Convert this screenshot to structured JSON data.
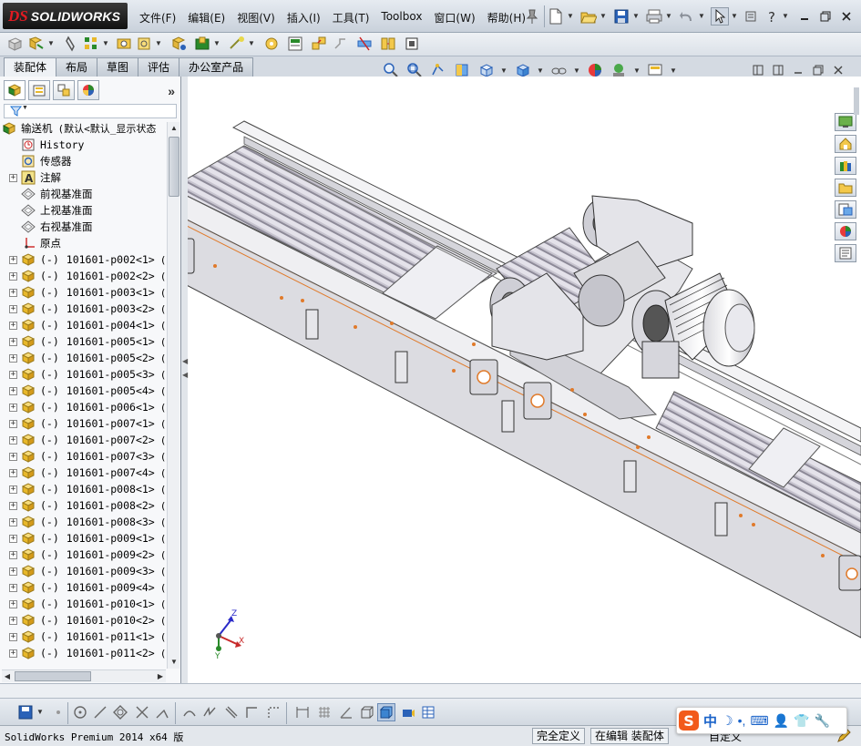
{
  "app": {
    "logo_ds": "DS",
    "logo_name": "SOLIDWORKS"
  },
  "menu": [
    {
      "label": "文件(F)"
    },
    {
      "label": "编辑(E)"
    },
    {
      "label": "视图(V)"
    },
    {
      "label": "插入(I)"
    },
    {
      "label": "工具(T)"
    },
    {
      "label": "Toolbox"
    },
    {
      "label": "窗口(W)"
    },
    {
      "label": "帮助(H)"
    }
  ],
  "command_tabs": [
    {
      "label": "装配体",
      "active": true
    },
    {
      "label": "布局",
      "active": false
    },
    {
      "label": "草图",
      "active": false
    },
    {
      "label": "评估",
      "active": false
    },
    {
      "label": "办公室产品",
      "active": false
    }
  ],
  "feature_tree": {
    "root": {
      "label": "输送机",
      "config": "(默认<默认_显示状态"
    },
    "items": [
      {
        "label": "History",
        "icon": "history-icon"
      },
      {
        "label": "传感器",
        "icon": "sensor-icon"
      },
      {
        "label": "注解",
        "icon": "annotation-icon",
        "expandable": true
      },
      {
        "label": "前视基准面",
        "icon": "plane-icon"
      },
      {
        "label": "上视基准面",
        "icon": "plane-icon"
      },
      {
        "label": "右视基准面",
        "icon": "plane-icon"
      },
      {
        "label": "原点",
        "icon": "origin-icon"
      }
    ],
    "components": [
      {
        "prefix": "(-)",
        "name": "101601-p002<1>",
        "config": "(默认"
      },
      {
        "prefix": "(-)",
        "name": "101601-p002<2>",
        "config": "(默认"
      },
      {
        "prefix": "(-)",
        "name": "101601-p003<1>",
        "config": "(默认"
      },
      {
        "prefix": "(-)",
        "name": "101601-p003<2>",
        "config": "(默认"
      },
      {
        "prefix": "(-)",
        "name": "101601-p004<1>",
        "config": "(默认"
      },
      {
        "prefix": "(-)",
        "name": "101601-p005<1>",
        "config": "(默认"
      },
      {
        "prefix": "(-)",
        "name": "101601-p005<2>",
        "config": "(默认"
      },
      {
        "prefix": "(-)",
        "name": "101601-p005<3>",
        "config": "(默认"
      },
      {
        "prefix": "(-)",
        "name": "101601-p005<4>",
        "config": "(默认"
      },
      {
        "prefix": "(-)",
        "name": "101601-p006<1>",
        "config": "(默认"
      },
      {
        "prefix": "(-)",
        "name": "101601-p007<1>",
        "config": "(默认"
      },
      {
        "prefix": "(-)",
        "name": "101601-p007<2>",
        "config": "(默认"
      },
      {
        "prefix": "(-)",
        "name": "101601-p007<3>",
        "config": "(默认"
      },
      {
        "prefix": "(-)",
        "name": "101601-p007<4>",
        "config": "(默认"
      },
      {
        "prefix": "(-)",
        "name": "101601-p008<1>",
        "config": "(默认"
      },
      {
        "prefix": "(-)",
        "name": "101601-p008<2>",
        "config": "(默认"
      },
      {
        "prefix": "(-)",
        "name": "101601-p008<3>",
        "config": "(默认"
      },
      {
        "prefix": "(-)",
        "name": "101601-p009<1>",
        "config": "(默认"
      },
      {
        "prefix": "(-)",
        "name": "101601-p009<2>",
        "config": "(默认"
      },
      {
        "prefix": "(-)",
        "name": "101601-p009<3>",
        "config": "(默认"
      },
      {
        "prefix": "(-)",
        "name": "101601-p009<4>",
        "config": "(默认"
      },
      {
        "prefix": "(-)",
        "name": "101601-p010<1>",
        "config": "(默认"
      },
      {
        "prefix": "(-)",
        "name": "101601-p010<2>",
        "config": "(默认"
      },
      {
        "prefix": "(-)",
        "name": "101601-p011<1>",
        "config": "(默认"
      },
      {
        "prefix": "(-)",
        "name": "101601-p011<2>",
        "config": "(默认"
      }
    ]
  },
  "triad": {
    "z": "Z",
    "x": "X",
    "y": "Y"
  },
  "status": {
    "product": "SolidWorks Premium 2014 x64 版",
    "definition": "完全定义",
    "mode": "在编辑 装配体",
    "custom": "自定义"
  },
  "ime": {
    "zh": "中"
  },
  "colors": {
    "accent_orange": "#e07a2a",
    "logo_red": "#e11b22",
    "ime_orange": "#f25a1b",
    "ime_blue": "#1a63c9"
  }
}
